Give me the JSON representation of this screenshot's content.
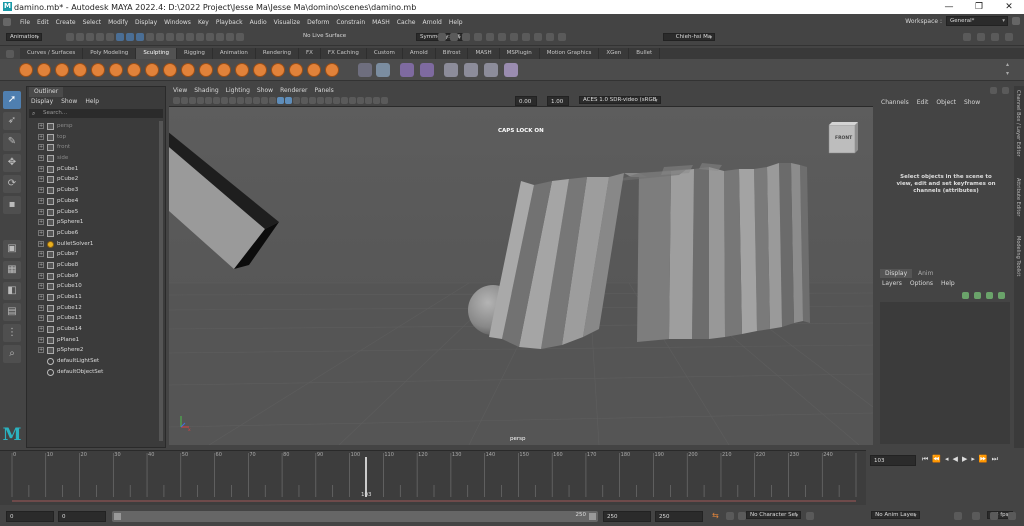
{
  "window": {
    "title": "damino.mb* - Autodesk MAYA 2022.4: D:\\2022 Project\\Jesse Ma\\Jesse Ma\\domino\\scenes\\damino.mb",
    "minimize": "—",
    "maximize": "❐",
    "close": "✕"
  },
  "menubar": {
    "items": [
      "File",
      "Edit",
      "Create",
      "Select",
      "Modify",
      "Display",
      "Windows",
      "Key",
      "Playback",
      "Audio",
      "Visualize",
      "Deform",
      "Constrain",
      "MASH",
      "Cache",
      "Arnold",
      "Help"
    ],
    "workspace_label": "Workspace :",
    "workspace_value": "General*"
  },
  "statusline": {
    "menuset": "Animation",
    "live_surface": "No Live Surface",
    "symmetry": "Symmetry: Off",
    "user": "Chieh-hsi Ma"
  },
  "shelf": {
    "tabs": [
      "Curves / Surfaces",
      "Poly Modeling",
      "Sculpting",
      "Rigging",
      "Animation",
      "Rendering",
      "FX",
      "FX Caching",
      "Custom",
      "Arnold",
      "Bifrost",
      "MASH",
      "MSPlugin",
      "Motion Graphics",
      "XGen",
      "Bullet"
    ],
    "active_tab": "Sculpting"
  },
  "outliner": {
    "tab": "Outliner",
    "menu": [
      "Display",
      "Show",
      "Help"
    ],
    "search_placeholder": "Search...",
    "items": [
      {
        "name": "persp",
        "dim": true,
        "kind": "cam"
      },
      {
        "name": "top",
        "dim": true,
        "kind": "cam"
      },
      {
        "name": "front",
        "dim": true,
        "kind": "cam"
      },
      {
        "name": "side",
        "dim": true,
        "kind": "cam"
      },
      {
        "name": "pCube1",
        "dim": false,
        "kind": "mesh"
      },
      {
        "name": "pCube2",
        "dim": false,
        "kind": "mesh"
      },
      {
        "name": "pCube3",
        "dim": false,
        "kind": "mesh"
      },
      {
        "name": "pCube4",
        "dim": false,
        "kind": "mesh"
      },
      {
        "name": "pCube5",
        "dim": false,
        "kind": "mesh"
      },
      {
        "name": "pSphere1",
        "dim": false,
        "kind": "mesh"
      },
      {
        "name": "pCube6",
        "dim": false,
        "kind": "mesh"
      },
      {
        "name": "bulletSolver1",
        "dim": false,
        "kind": "solver"
      },
      {
        "name": "pCube7",
        "dim": false,
        "kind": "mesh"
      },
      {
        "name": "pCube8",
        "dim": false,
        "kind": "mesh"
      },
      {
        "name": "pCube9",
        "dim": false,
        "kind": "mesh"
      },
      {
        "name": "pCube10",
        "dim": false,
        "kind": "mesh"
      },
      {
        "name": "pCube11",
        "dim": false,
        "kind": "mesh"
      },
      {
        "name": "pCube12",
        "dim": false,
        "kind": "mesh"
      },
      {
        "name": "pCube13",
        "dim": false,
        "kind": "mesh"
      },
      {
        "name": "pCube14",
        "dim": false,
        "kind": "mesh"
      },
      {
        "name": "pPlane1",
        "dim": false,
        "kind": "mesh"
      },
      {
        "name": "pSphere2",
        "dim": false,
        "kind": "mesh"
      },
      {
        "name": "defaultLightSet",
        "dim": false,
        "kind": "set"
      },
      {
        "name": "defaultObjectSet",
        "dim": false,
        "kind": "set"
      }
    ]
  },
  "viewport": {
    "menu": [
      "View",
      "Shading",
      "Lighting",
      "Show",
      "Renderer",
      "Panels"
    ],
    "exposure": "0.00",
    "gamma": "1.00",
    "colorspace": "ACES 1.0 SDR-video (sRGB",
    "hud_message": "CAPS LOCK ON",
    "camera_label": "persp",
    "viewcube_label": "FRONT"
  },
  "channelbox": {
    "menu": [
      "Channels",
      "Edit",
      "Object",
      "Show"
    ],
    "message": "Select objects in the scene to view, edit and set keyframes on channels (attributes)"
  },
  "layereditor": {
    "tabs": [
      "Display",
      "Anim"
    ],
    "menu": [
      "Layers",
      "Options",
      "Help"
    ]
  },
  "side_tabs": [
    "Channel Box / Layer Editor",
    "Attribute Editor",
    "Modeling Toolkit"
  ],
  "timeline": {
    "ticks": [
      "0",
      "10",
      "20",
      "30",
      "40",
      "50",
      "60",
      "70",
      "80",
      "90",
      "100",
      "110",
      "120",
      "130",
      "140",
      "150",
      "160",
      "170",
      "180",
      "190",
      "200",
      "210",
      "220",
      "230",
      "240"
    ],
    "current_frame": "103",
    "current_frame_field": "103"
  },
  "range": {
    "start": "0",
    "anim_start": "0",
    "range_end_label": "250",
    "anim_end": "250",
    "end": "250",
    "character_set": "No Character Set",
    "anim_layer": "No Anim Layer",
    "fps": "24 fps"
  }
}
